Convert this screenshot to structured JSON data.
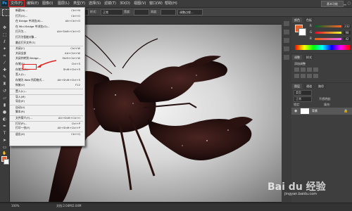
{
  "app": {
    "logo": "Ps",
    "workspace": "基本功能"
  },
  "menubar": [
    "文件(F)",
    "编辑(E)",
    "图像(I)",
    "图层(L)",
    "类型(Y)",
    "选择(S)",
    "滤镜(T)",
    "3D(D)",
    "视图(V)",
    "窗口(W)",
    "帮助(H)"
  ],
  "options_bar": {
    "feather_label": "羽化:",
    "feather_value": "0 像素",
    "style_label": "样式:",
    "style_value": "正常",
    "width_label": "宽度:",
    "height_label": "高度:",
    "refine_button": "调整边缘..."
  },
  "file_menu": [
    {
      "label": "新建(N)...",
      "shortcut": "Ctrl+N"
    },
    {
      "label": "打开(O)...",
      "shortcut": "Ctrl+O"
    },
    {
      "label": "在 Bridge 中浏览(B)...",
      "shortcut": "Alt+Ctrl+O"
    },
    {
      "label": "在 Mini Bridge 中浏览(G)...",
      "shortcut": ""
    },
    {
      "label": "打开为...",
      "shortcut": "Alt+Shift+Ctrl+O"
    },
    {
      "label": "打开为智能对象...",
      "shortcut": ""
    },
    {
      "label": "最近打开文件(T)",
      "shortcut": "",
      "separator_before": false
    },
    {
      "label": "关闭(C)",
      "shortcut": "Ctrl+W",
      "separator_before": true
    },
    {
      "label": "关闭全部",
      "shortcut": "Alt+Ctrl+W"
    },
    {
      "label": "关闭并转到 Bridge...",
      "shortcut": "Shift+Ctrl+W"
    },
    {
      "label": "存储(S)",
      "shortcut": "Ctrl+S"
    },
    {
      "label": "存储为(A)...",
      "shortcut": "Shift+Ctrl+S"
    },
    {
      "label": "签入(I)...",
      "shortcut": ""
    },
    {
      "label": "存储为 Web 所用格式...",
      "shortcut": "Alt+Shift+Ctrl+S"
    },
    {
      "label": "恢复(V)",
      "shortcut": "F12"
    },
    {
      "label": "置入(L)...",
      "shortcut": "",
      "separator_before": true
    },
    {
      "label": "导入(M)",
      "shortcut": "",
      "separator_before": true
    },
    {
      "label": "导出(E)",
      "shortcut": ""
    },
    {
      "label": "自动(U)",
      "shortcut": "",
      "separator_before": true
    },
    {
      "label": "脚本(R)",
      "shortcut": ""
    },
    {
      "label": "文件简介(F)...",
      "shortcut": "Alt+Shift+Ctrl+I",
      "separator_before": true
    },
    {
      "label": "打印(P)...",
      "shortcut": "Ctrl+P",
      "separator_before": true
    },
    {
      "label": "打印一份(Y)",
      "shortcut": "Alt+Shift+Ctrl+P"
    },
    {
      "label": "退出(X)",
      "shortcut": "Ctrl+Q",
      "separator_before": true
    }
  ],
  "color_panel": {
    "tab1": "颜色",
    "tab2": "色板",
    "r_label": "R",
    "g_label": "G",
    "b_label": "B",
    "r_value": "232",
    "g_value": "98",
    "b_value": "42",
    "fg_color": "#e8622a"
  },
  "adjust_panel": {
    "tab1": "调整",
    "tab2": "样式",
    "title": "添加调整"
  },
  "layers_panel": {
    "tab1": "图层",
    "tab2": "通道",
    "tab3": "路径",
    "kind_label": "类型",
    "mode": "正常",
    "opacity_label": "不透明度:",
    "lock_label": "锁定:",
    "fill_label": "填充:",
    "layer_name": "背景"
  },
  "status": {
    "zoom": "100%",
    "doc": "文档:2.04M/2.04M"
  },
  "watermark": {
    "main": "Bai du 经验",
    "url": "jingyan.baidu.com"
  },
  "colors": {
    "highlight": "#e02020"
  }
}
